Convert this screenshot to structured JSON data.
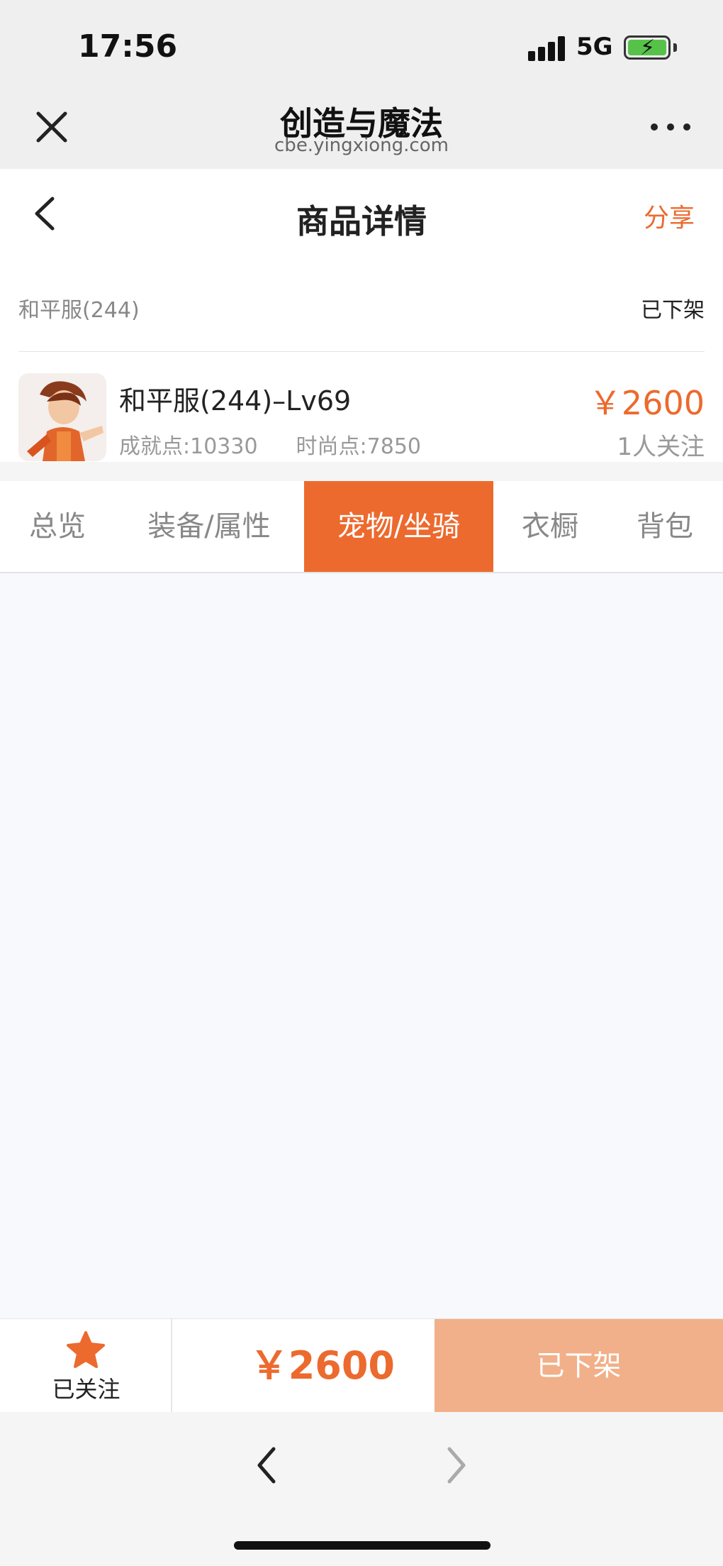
{
  "status_bar": {
    "time": "17:56",
    "network": "5G",
    "icons": [
      "signal-icon",
      "battery-charging-icon"
    ]
  },
  "webview": {
    "title": "创造与魔法",
    "url": "cbe.yingxiong.com",
    "icons": [
      "close-icon",
      "more-icon"
    ]
  },
  "header": {
    "title": "商品详情",
    "share_label": "分享",
    "icons": [
      "back-icon"
    ]
  },
  "server": {
    "name": "和平服(244)",
    "status": "已下架"
  },
  "product": {
    "name": "和平服(244)–Lv69",
    "achievement": "成就点:10330",
    "fashion": "时尚点:7850",
    "price": "￥2600",
    "followers": "1人关注"
  },
  "tabs": [
    {
      "label": "总览",
      "active": false
    },
    {
      "label": "装备/属性",
      "active": false
    },
    {
      "label": "宠物/坐骑",
      "active": true
    },
    {
      "label": "衣橱",
      "active": false
    },
    {
      "label": "背包",
      "active": false
    }
  ],
  "action_bar": {
    "follow_label": "已关注",
    "price": "￥2600",
    "status_button": "已下架",
    "icons": [
      "star-icon"
    ]
  },
  "browser_nav": {
    "icons": [
      "chevron-left-icon",
      "chevron-right-icon"
    ]
  },
  "colors": {
    "accent": "#ec6a2e",
    "disabled_button": "#f1b089",
    "content_bg": "#f7f9fc"
  }
}
